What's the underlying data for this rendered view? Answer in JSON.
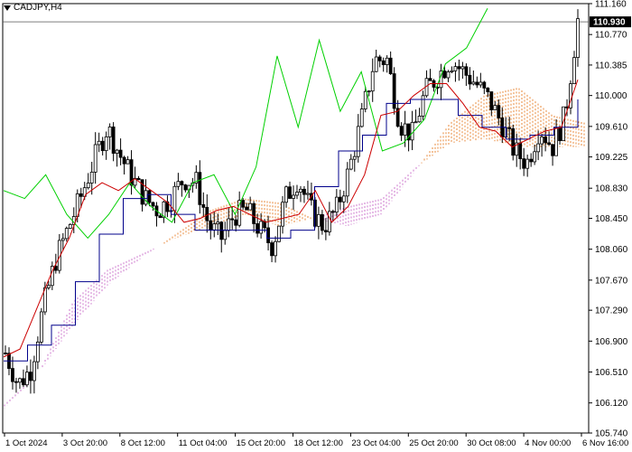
{
  "window": {
    "symbol_label": "CADJPY,H4"
  },
  "price_axis": {
    "ticks": [
      "111.160",
      "110.770",
      "110.385",
      "110.000",
      "109.610",
      "109.225",
      "108.830",
      "108.450",
      "108.060",
      "107.670",
      "107.290",
      "106.900",
      "106.510",
      "106.120",
      "105.740"
    ],
    "current_price": "110.930"
  },
  "time_axis": {
    "labels": [
      "1 Oct 2024",
      "3 Oct 20:00",
      "8 Oct 12:00",
      "11 Oct 04:00",
      "15 Oct 20:00",
      "18 Oct 12:00",
      "23 Oct 04:00",
      "25 Oct 20:00",
      "30 Oct 08:00",
      "4 Nov 00:00",
      "6 Nov 16:00"
    ]
  },
  "colors": {
    "tenkan": "#cc0000",
    "kijun": "#00008b",
    "chikou": "#00d000",
    "cloud_bull": "#e8883a",
    "cloud_bear": "#cc77cc",
    "candle": "#000000",
    "grid": "#000000"
  },
  "chart_data": {
    "type": "candlestick",
    "ylim": [
      105.74,
      111.16
    ],
    "ohlc_anchors": [
      106.75,
      106.35,
      106.55,
      107.35,
      107.95,
      108.35,
      108.75,
      109.2,
      109.6,
      109.25,
      108.95,
      108.7,
      108.55,
      108.7,
      108.95,
      108.9,
      108.35,
      108.2,
      108.5,
      108.55,
      108.3,
      108.1,
      108.7,
      108.95,
      108.55,
      108.35,
      108.55,
      109.05,
      109.7,
      110.45,
      110.45,
      109.65,
      109.5,
      110.05,
      110.25,
      110.45,
      110.3,
      110.15,
      109.95,
      109.65,
      109.3,
      109.15,
      109.6,
      109.35,
      109.75,
      110.95
    ],
    "tenkan": [
      106.7,
      106.8,
      107.3,
      107.8,
      108.2,
      108.75,
      108.9,
      108.8,
      108.95,
      108.8,
      108.65,
      108.4,
      108.45,
      108.55,
      108.6,
      108.5,
      108.4,
      108.45,
      108.5,
      108.8,
      108.4,
      108.6,
      109.0,
      109.75,
      109.8,
      110.0,
      110.15,
      110.15,
      109.9,
      109.6,
      109.55,
      109.35,
      109.45,
      109.55,
      109.6,
      110.2
    ],
    "kijun": [
      106.65,
      106.85,
      107.1,
      107.65,
      108.25,
      108.7,
      108.75,
      108.5,
      108.3,
      108.3,
      108.3,
      108.2,
      108.3,
      108.85,
      109.3,
      109.5,
      109.9,
      109.95,
      109.95,
      109.75,
      109.6,
      109.45,
      109.5,
      109.6,
      109.95
    ],
    "chikou": [
      108.8,
      108.7,
      109.0,
      108.5,
      108.2,
      108.5,
      108.9,
      108.6,
      108.4,
      108.9,
      109.0,
      108.5,
      109.1,
      110.5,
      109.6,
      110.7,
      109.8,
      110.3,
      109.3,
      109.4,
      109.7,
      110.4,
      110.6,
      111.1
    ],
    "senkou_a": [
      106.05,
      106.5,
      107.1,
      107.6,
      107.95,
      108.25,
      108.55,
      108.7,
      108.65,
      108.45,
      108.35,
      108.5,
      109.05,
      109.65,
      110.0,
      110.1,
      109.75,
      109.65
    ],
    "senkou_b": [
      106.1,
      106.5,
      107.4,
      107.8,
      108.0,
      108.2,
      108.35,
      108.5,
      108.35,
      108.45,
      108.6,
      108.7,
      109.1,
      109.4,
      109.45,
      109.35,
      109.35
    ]
  }
}
